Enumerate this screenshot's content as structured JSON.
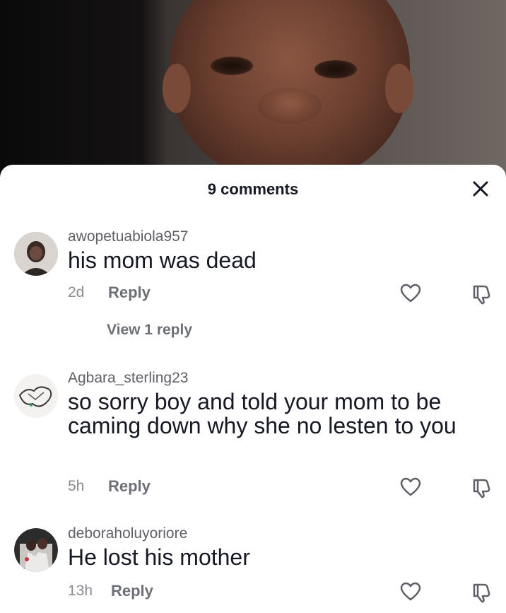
{
  "header": {
    "title": "9 comments"
  },
  "comments": [
    {
      "username": "awopetuabiola957",
      "text": "his mom was dead",
      "time": "2d",
      "reply_label": "Reply",
      "view_replies": "View 1 reply"
    },
    {
      "username": "Agbara_sterling23",
      "text": "so sorry boy and told your mom to be caming down why she no lesten to you",
      "time": "5h",
      "reply_label": "Reply"
    },
    {
      "username": "deboraholuyoriore",
      "text": "He lost his mother",
      "time": "13h",
      "reply_label": "Reply"
    }
  ],
  "icons": {
    "close": "close-icon",
    "like": "heart-outline-icon",
    "dislike": "thumbs-down-icon"
  },
  "colors": {
    "sheet_bg": "#ffffff",
    "primary_text": "#161823",
    "secondary_text": "#8a8b91"
  }
}
